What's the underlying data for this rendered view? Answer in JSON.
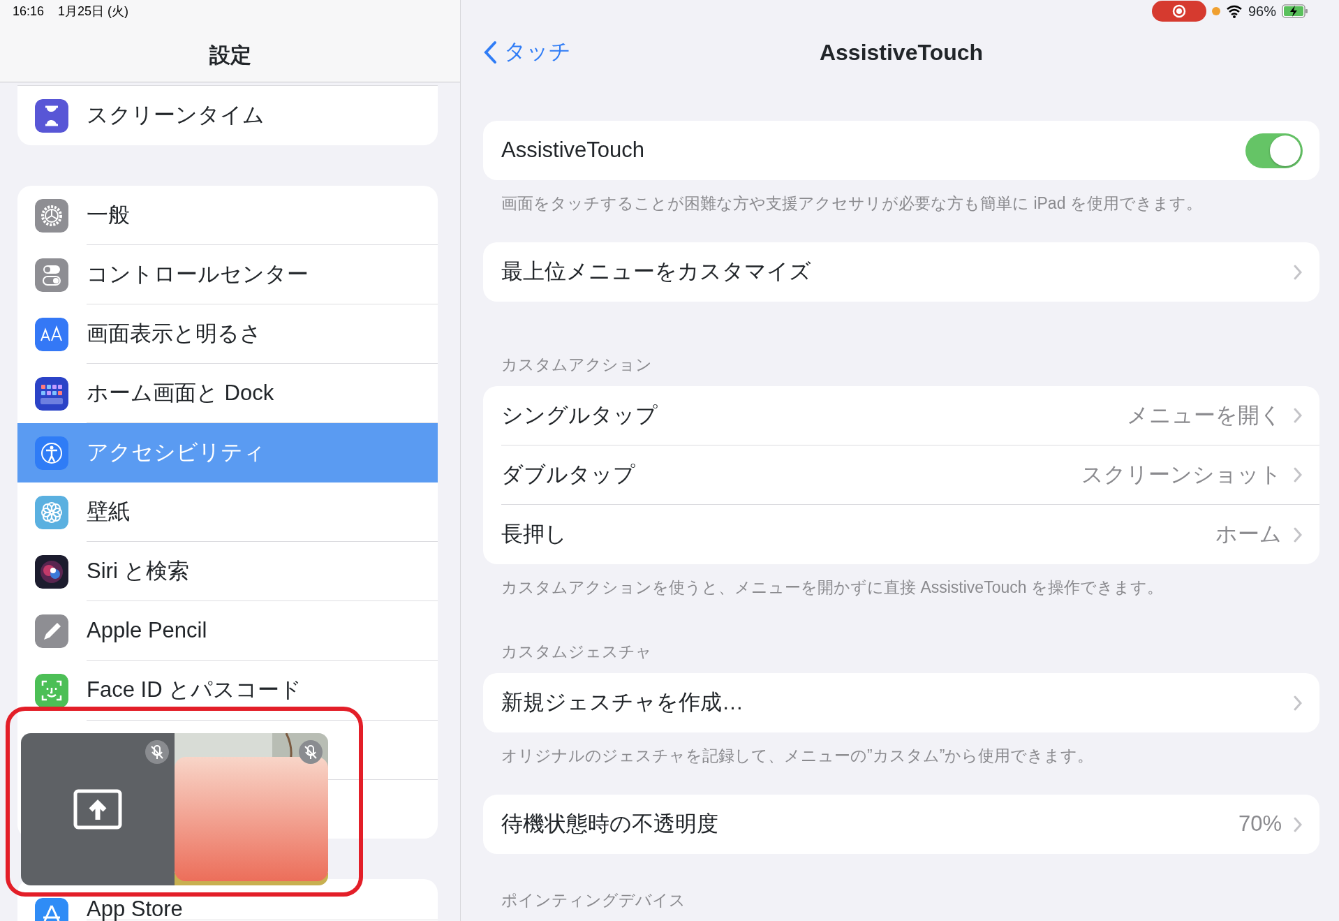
{
  "status_bar": {
    "time": "16:16",
    "date": "1月25日 (火)",
    "battery": "96%"
  },
  "sidebar": {
    "title": "設定",
    "groups": [
      [
        {
          "label": "スクリーンタイム",
          "selected": false
        }
      ],
      [
        {
          "label": "一般",
          "selected": false
        },
        {
          "label": "コントロールセンター",
          "selected": false
        },
        {
          "label": "画面表示と明るさ",
          "selected": false
        },
        {
          "label": "ホーム画面と Dock",
          "selected": false
        },
        {
          "label": "アクセシビリティ",
          "selected": true
        },
        {
          "label": "壁紙",
          "selected": false
        },
        {
          "label": "Siri と検索",
          "selected": false
        },
        {
          "label": "Apple Pencil",
          "selected": false
        },
        {
          "label": "Face ID とパスコード",
          "selected": false
        }
      ],
      [
        {
          "label": "App Store",
          "selected": false
        }
      ]
    ]
  },
  "detail": {
    "back": "タッチ",
    "title": "AssistiveTouch",
    "sections": [
      {
        "rows": [
          {
            "kind": "toggle",
            "label": "AssistiveTouch",
            "on": true
          }
        ],
        "footer": "画面をタッチすることが困難な方や支援アクセサリが必要な方も簡単に iPad を使用できます。"
      },
      {
        "rows": [
          {
            "kind": "link",
            "label": "最上位メニューをカスタマイズ"
          }
        ]
      },
      {
        "header": "カスタムアクション",
        "rows": [
          {
            "kind": "link",
            "label": "シングルタップ",
            "value": "メニューを開く"
          },
          {
            "kind": "link",
            "label": "ダブルタップ",
            "value": "スクリーンショット"
          },
          {
            "kind": "link",
            "label": "長押し",
            "value": "ホーム"
          }
        ],
        "footer": "カスタムアクションを使うと、メニューを開かずに直接 AssistiveTouch を操作できます。"
      },
      {
        "header": "カスタムジェスチャ",
        "rows": [
          {
            "kind": "link",
            "label": "新規ジェスチャを作成…"
          }
        ],
        "footer": "オリジナルのジェスチャを記録して、メニューの”カスタム”から使用できます。"
      },
      {
        "rows": [
          {
            "kind": "link",
            "label": "待機状態時の不透明度",
            "value": "70%"
          }
        ]
      },
      {
        "header": "ポインティングデバイス"
      }
    ]
  }
}
